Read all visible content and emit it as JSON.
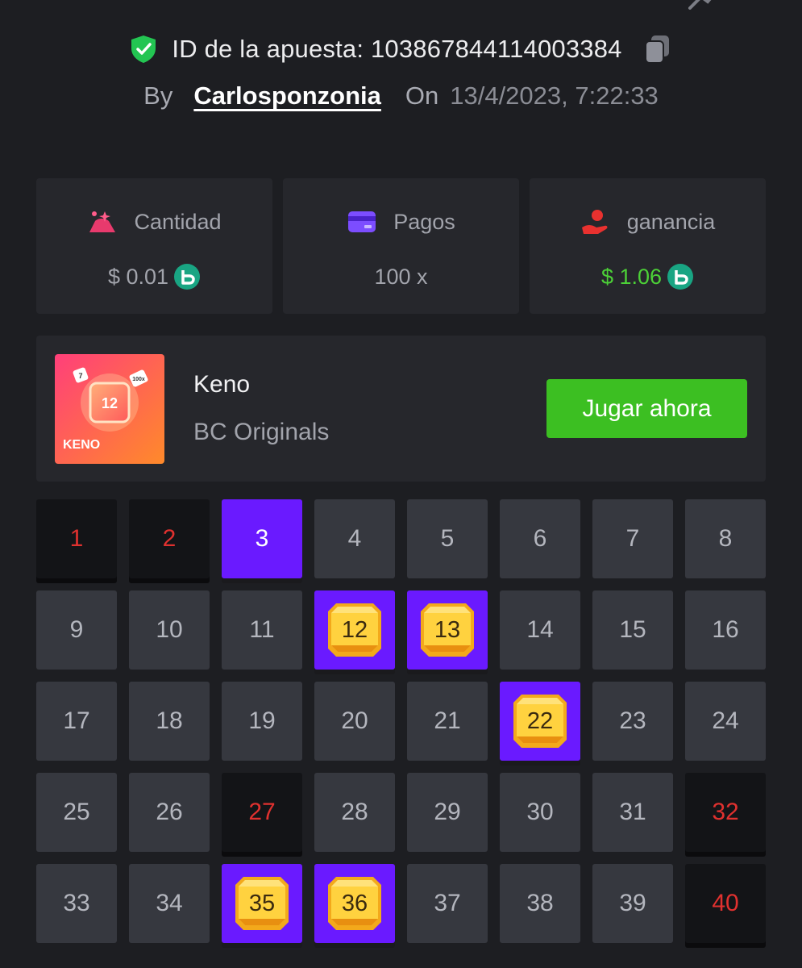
{
  "header": {
    "bet_id_label": "ID de la apuesta: 103867844114003384",
    "by_label": "By",
    "username": "Carlosponzonia",
    "on_label": "On",
    "datetime": "13/4/2023, 7:22:33"
  },
  "stats": [
    {
      "icon": "amount-icon",
      "label": "Cantidad",
      "value": "$ 0.01",
      "coin": true
    },
    {
      "icon": "card-icon",
      "label": "Pagos",
      "value": "100 x",
      "coin": false
    },
    {
      "icon": "profit-icon",
      "label": "ganancia",
      "value": "$ 1.06",
      "coin": true
    }
  ],
  "game": {
    "thumb_title": "KENO",
    "thumb_number": "12",
    "thumb_chip_left": "7",
    "thumb_chip_right": "100x",
    "name": "Keno",
    "provider": "BC Originals",
    "play_label": "Jugar ahora"
  },
  "colors": {
    "accent_purple": "#6a1aff",
    "play_green": "#3cbf22",
    "win_green": "#4cd137",
    "miss_red": "#e0312f"
  },
  "keno": {
    "tiles": [
      {
        "n": "1",
        "state": "miss"
      },
      {
        "n": "2",
        "state": "miss"
      },
      {
        "n": "3",
        "state": "picked"
      },
      {
        "n": "4",
        "state": "normal"
      },
      {
        "n": "5",
        "state": "normal"
      },
      {
        "n": "6",
        "state": "normal"
      },
      {
        "n": "7",
        "state": "normal"
      },
      {
        "n": "8",
        "state": "normal"
      },
      {
        "n": "9",
        "state": "normal"
      },
      {
        "n": "10",
        "state": "normal"
      },
      {
        "n": "11",
        "state": "normal"
      },
      {
        "n": "12",
        "state": "hit"
      },
      {
        "n": "13",
        "state": "hit"
      },
      {
        "n": "14",
        "state": "normal"
      },
      {
        "n": "15",
        "state": "normal"
      },
      {
        "n": "16",
        "state": "normal"
      },
      {
        "n": "17",
        "state": "normal"
      },
      {
        "n": "18",
        "state": "normal"
      },
      {
        "n": "19",
        "state": "normal"
      },
      {
        "n": "20",
        "state": "normal"
      },
      {
        "n": "21",
        "state": "normal"
      },
      {
        "n": "22",
        "state": "hit"
      },
      {
        "n": "23",
        "state": "normal"
      },
      {
        "n": "24",
        "state": "normal"
      },
      {
        "n": "25",
        "state": "normal"
      },
      {
        "n": "26",
        "state": "normal"
      },
      {
        "n": "27",
        "state": "miss"
      },
      {
        "n": "28",
        "state": "normal"
      },
      {
        "n": "29",
        "state": "normal"
      },
      {
        "n": "30",
        "state": "normal"
      },
      {
        "n": "31",
        "state": "normal"
      },
      {
        "n": "32",
        "state": "miss"
      },
      {
        "n": "33",
        "state": "normal"
      },
      {
        "n": "34",
        "state": "normal"
      },
      {
        "n": "35",
        "state": "hit"
      },
      {
        "n": "36",
        "state": "hit"
      },
      {
        "n": "37",
        "state": "normal"
      },
      {
        "n": "38",
        "state": "normal"
      },
      {
        "n": "39",
        "state": "normal"
      },
      {
        "n": "40",
        "state": "miss"
      }
    ]
  }
}
